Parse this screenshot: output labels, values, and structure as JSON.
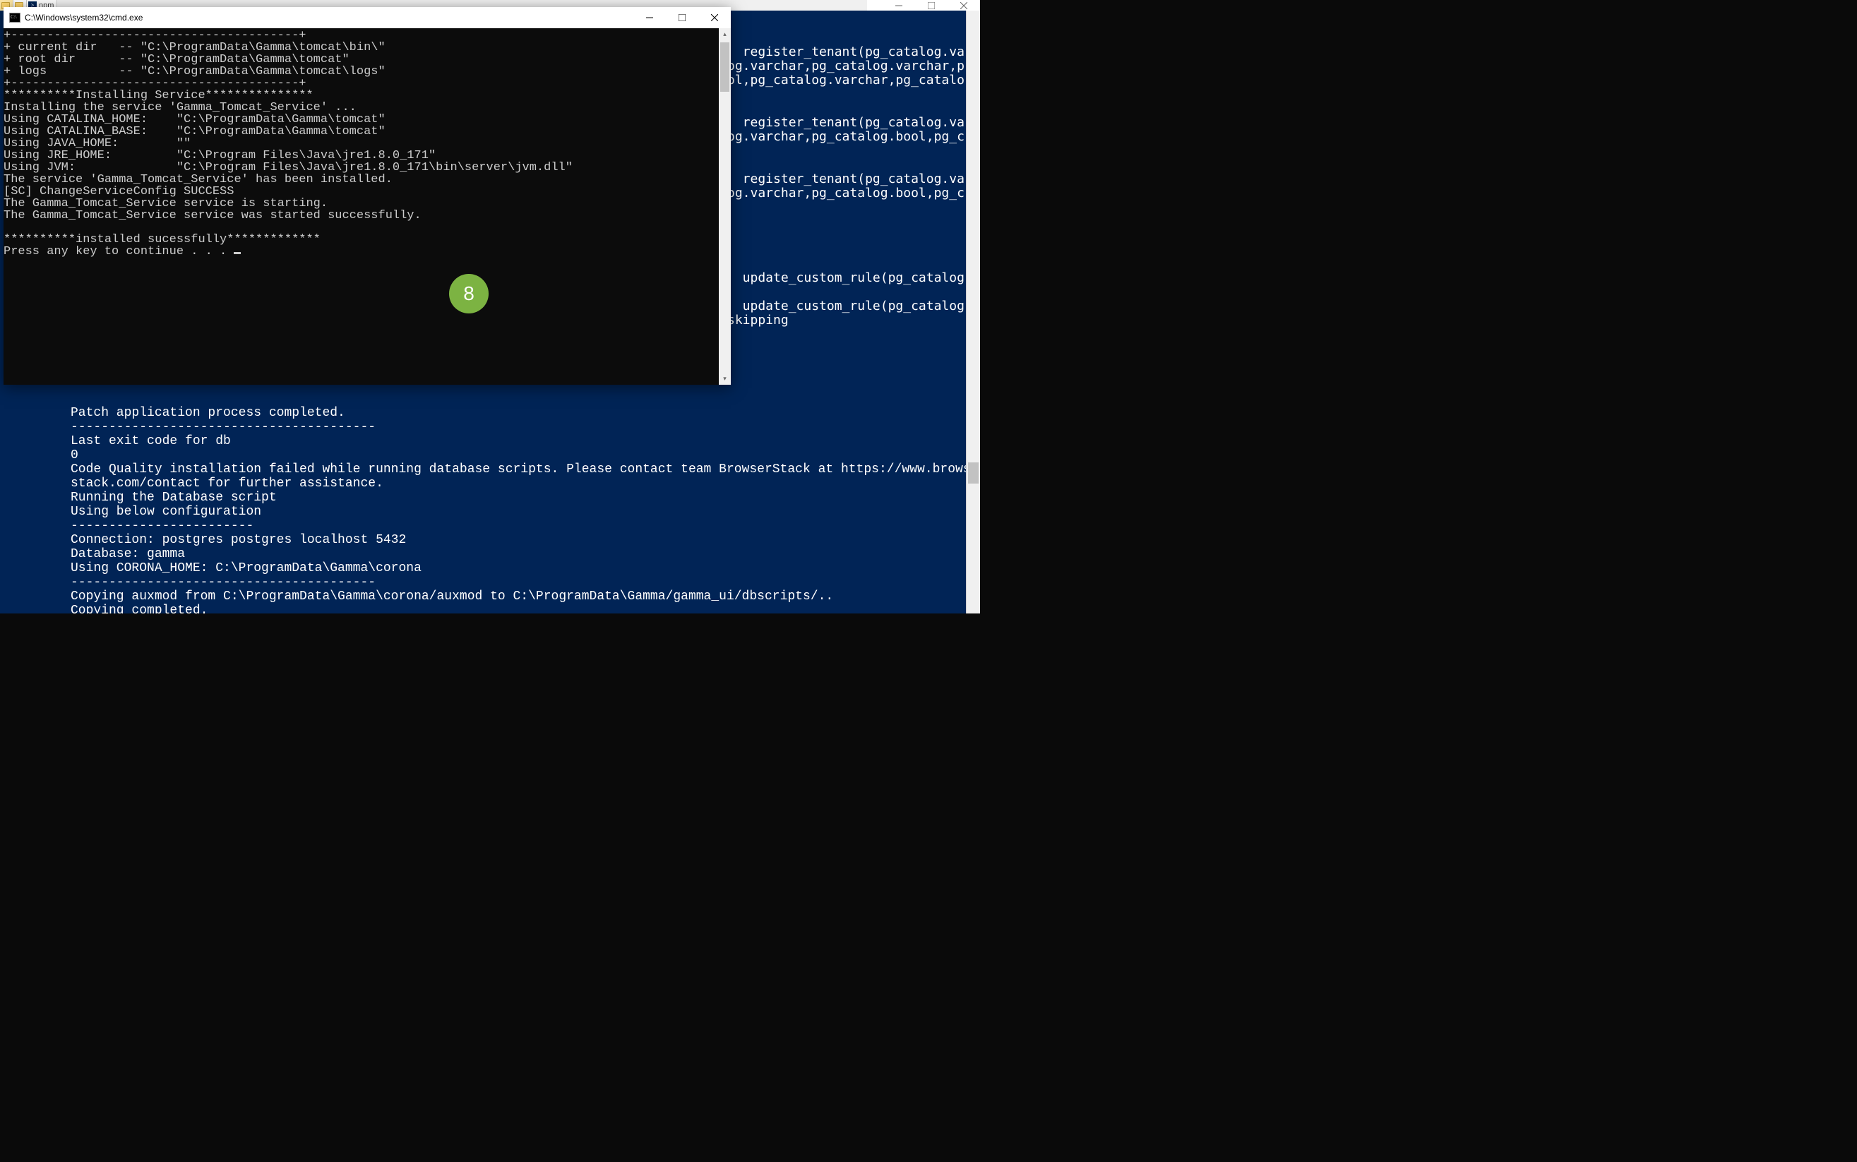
{
  "top_tabs": {
    "npm_label": "npm"
  },
  "bg_window": {
    "sql_lines": "\n  register_tenant(pg_catalog.var\nog.varchar,pg_catalog.varchar,p\nol,pg_catalog.varchar,pg_catalo\n\n\n  register_tenant(pg_catalog.var\nog.varchar,pg_catalog.bool,pg_c\n\n\n  register_tenant(pg_catalog.var\nog.varchar,pg_catalog.bool,pg_c\n\n\n\n\n\n  update_custom_rule(pg_catalog.\n\n  update_custom_rule(pg_catalog.\nskipping"
  },
  "cmd": {
    "title": "C:\\Windows\\system32\\cmd.exe",
    "output": "+----------------------------------------+\n+ current dir   -- \"C:\\ProgramData\\Gamma\\tomcat\\bin\\\"\n+ root dir      -- \"C:\\ProgramData\\Gamma\\tomcat\"\n+ logs          -- \"C:\\ProgramData\\Gamma\\tomcat\\logs\"\n+----------------------------------------+\n**********Installing Service***************\nInstalling the service 'Gamma_Tomcat_Service' ...\nUsing CATALINA_HOME:    \"C:\\ProgramData\\Gamma\\tomcat\"\nUsing CATALINA_BASE:    \"C:\\ProgramData\\Gamma\\tomcat\"\nUsing JAVA_HOME:        \"\"\nUsing JRE_HOME:         \"C:\\Program Files\\Java\\jre1.8.0_171\"\nUsing JVM:              \"C:\\Program Files\\Java\\jre1.8.0_171\\bin\\server\\jvm.dll\"\nThe service 'Gamma_Tomcat_Service' has been installed.\n[SC] ChangeServiceConfig SUCCESS\nThe Gamma_Tomcat_Service service is starting.\nThe Gamma_Tomcat_Service service was started successfully.\n\n**********installed sucessfully*************\nPress any key to continue . . . "
  },
  "ps": {
    "output": "Patch application process completed.\n----------------------------------------\nLast exit code for db\n0\nCode Quality installation failed while running database scripts. Please contact team BrowserStack at https://www.browser\nstack.com/contact for further assistance.\nRunning the Database script\nUsing below configuration\n------------------------\nConnection: postgres postgres localhost 5432\nDatabase: gamma\nUsing CORONA_HOME: C:\\ProgramData\\Gamma\\corona\n----------------------------------------\nCopying auxmod from C:\\ProgramData\\Gamma\\corona/auxmod to C:\\ProgramData\\Gamma/gamma_ui/dbscripts/..\nCopying completed.\nRunning the data mapper tool\nData mapper tool execution completed.\nStarting Tomcat server"
  },
  "badge": {
    "number": "8"
  }
}
